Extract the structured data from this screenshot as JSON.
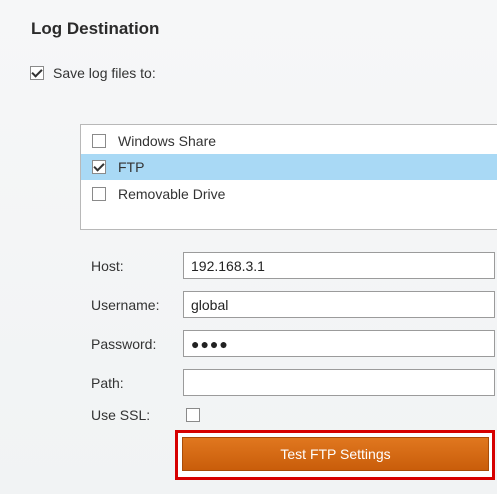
{
  "section": {
    "title": "Log Destination"
  },
  "save_logs": {
    "label": "Save log files to:",
    "checked": true
  },
  "destinations": [
    {
      "label": "Windows Share",
      "checked": false,
      "selected": false
    },
    {
      "label": "FTP",
      "checked": true,
      "selected": true
    },
    {
      "label": "Removable Drive",
      "checked": false,
      "selected": false
    }
  ],
  "form": {
    "host": {
      "label": "Host:",
      "value": "192.168.3.1"
    },
    "username": {
      "label": "Username:",
      "value": "global"
    },
    "password": {
      "label": "Password:",
      "value": "●●●●"
    },
    "path": {
      "label": "Path:",
      "value": ""
    },
    "ssl": {
      "label": "Use SSL:",
      "checked": false
    }
  },
  "test_button": {
    "label": "Test FTP Settings"
  },
  "colors": {
    "accent": "#d5690f",
    "selection": "#a9d9f5",
    "highlight": "#d60000"
  }
}
